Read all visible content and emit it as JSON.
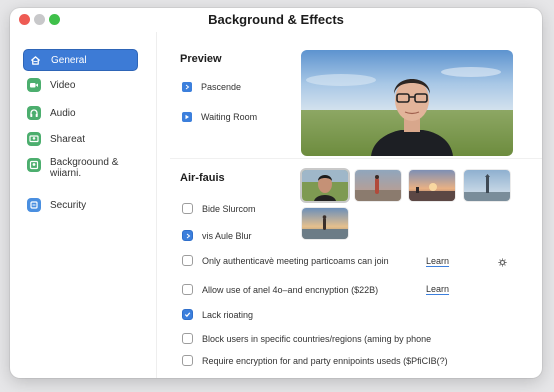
{
  "window": {
    "title": "Background & Effects"
  },
  "sidebar": {
    "items": [
      {
        "label": "General",
        "icon": "home-icon",
        "active": true,
        "color": "#3d7bd6"
      },
      {
        "label": "Video",
        "icon": "video-icon",
        "active": false,
        "color": "#4cae6e"
      },
      {
        "label": "Audio",
        "icon": "headphones-icon",
        "active": false,
        "color": "#4cae6e"
      },
      {
        "label": "Shareat",
        "icon": "share-screen-icon",
        "active": false,
        "color": "#4cae6e"
      },
      {
        "label": "Backgroound &",
        "label_line2": "wiiarni.",
        "icon": "background-icon",
        "active": false,
        "color": "#4cae6e"
      },
      {
        "label": "Security",
        "icon": "shield-icon",
        "active": false,
        "color": "#4a8fe0"
      }
    ]
  },
  "preview": {
    "title": "Preview",
    "options": [
      {
        "label": "Pascende"
      },
      {
        "label": "Waiting Room"
      }
    ]
  },
  "backgrounds": {
    "title": "Air-fauis",
    "thumbnails": [
      {
        "name": "portrait",
        "selected": true
      },
      {
        "name": "beach-figure",
        "selected": false
      },
      {
        "name": "sunset",
        "selected": false
      },
      {
        "name": "lighthouse",
        "selected": false
      },
      {
        "name": "shore-figure",
        "selected": false
      }
    ]
  },
  "settings": [
    {
      "label": "Bide Slurcom",
      "checked": false
    },
    {
      "label": "vis Aule Blur",
      "checked": true
    },
    {
      "label": "Only authenticavè meeting particoams can join",
      "checked": false,
      "learn": "Learn"
    },
    {
      "label": "Allow use of anel 4o–and encnyption ($22B)",
      "checked": false,
      "learn": "Learn"
    },
    {
      "label": "Lack rioating",
      "checked": true
    },
    {
      "label": "Block users in specific countries/regions (aming by phone",
      "checked": false
    },
    {
      "label": "Require encryption for and party ennipoints useds ($PfiCIB(?)",
      "checked": false
    }
  ],
  "colors": {
    "accent": "#3c7fdc"
  }
}
